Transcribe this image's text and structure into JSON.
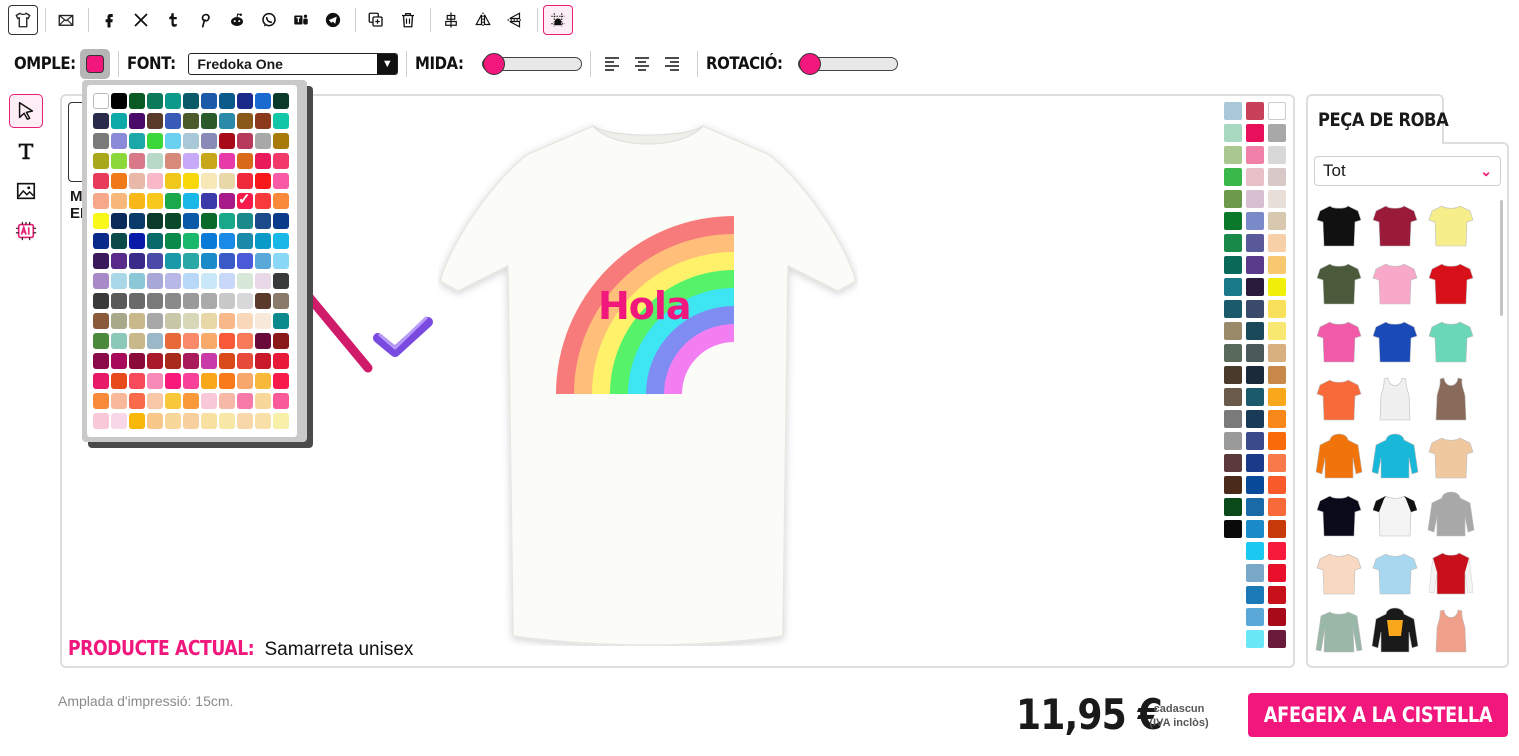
{
  "toolbar": {
    "icons": [
      "tshirt-icon",
      "mail-icon",
      "facebook-icon",
      "x-icon",
      "tumblr-icon",
      "pinterest-icon",
      "reddit-icon",
      "whatsapp-icon",
      "teams-icon",
      "telegram-icon",
      "copy-icon",
      "trash-icon",
      "center-vertical-icon",
      "flip-horizontal-icon",
      "flip-vertical-icon",
      "grid-icon"
    ]
  },
  "props": {
    "fill_label": "OMPLE:",
    "fill_color": "#f2177d",
    "font_label": "FONT:",
    "font_value": "Fredoka One",
    "size_label": "MIDA:",
    "rotation_label": "ROTACIÓ:",
    "slider_color": "#f2177d"
  },
  "canvas": {
    "side_text_1": "M",
    "side_text_2": "EL",
    "design_text": "Hola",
    "current_label": "PRODUCTE ACTUAL:",
    "current_value": "Samarreta unisex"
  },
  "picker_colors": [
    "#ffffff",
    "#000000",
    "#0a5a24",
    "#0b7a5a",
    "#0d9a8a",
    "#0b5a6a",
    "#1a5aa8",
    "#0a5a8a",
    "#1a2a8a",
    "#1a6ad0",
    "#0a3a2a",
    "#2a2a4a",
    "#0da8a8",
    "#4a0a6a",
    "#5a3a2a",
    "#3a5ab8",
    "#4a5a2a",
    "#2a5a2a",
    "#2a8aa8",
    "#8a5a1a",
    "#8a3a1a",
    "#10c8a8",
    "#7a7a7a",
    "#8a8ad8",
    "#1aa8a8",
    "#3ad83a",
    "#6ad0f0",
    "#a8c8d8",
    "#8a8ab8",
    "#a80a1a",
    "#b83a5a",
    "#a8a8a8",
    "#a87a0a",
    "#a8a81a",
    "#8ad83a",
    "#d87a8a",
    "#b8d8c8",
    "#d88a7a",
    "#c8a8f8",
    "#c8a81a",
    "#e83aa8",
    "#d86a1a",
    "#e81a5a",
    "#f23a6a",
    "#e83a5a",
    "#f07a1a",
    "#e8b8a8",
    "#f8b8c8",
    "#f0c81a",
    "#f8d80a",
    "#f8e8b8",
    "#e8d8a8",
    "#f02a3a",
    "#f81a1a",
    "#f85aa8",
    "#f8a88a",
    "#f8b87a",
    "#f8b81a",
    "#f8c81a",
    "#1aa84a",
    "#1ab8e8",
    "#3a3aa8",
    "#a81a8a",
    "#f81a4a",
    "#f83a3a",
    "#f88a3a",
    "#f8f81a",
    "#0a2a5a",
    "#0a3a6a",
    "#0a3a2a",
    "#0a4a2a",
    "#0a5aa8",
    "#0a6a2a",
    "#1aa88a",
    "#1a8a8a",
    "#1a4a8a",
    "#0a3a8a",
    "#0a2a8a",
    "#0a4a4a",
    "#0a1aa8",
    "#0a6a6a",
    "#0a8a4a",
    "#1ab86a",
    "#0a7ad8",
    "#1a8ae8",
    "#1a8aa8",
    "#0a9ac8",
    "#1ab8e8",
    "#3a1a5a",
    "#5a2a8a",
    "#3a2a8a",
    "#4a4aa8",
    "#1a9aa8",
    "#2aa8a8",
    "#1a8ac8",
    "#3a5ac8",
    "#4a5ad8",
    "#5aa8d8",
    "#8ad8f8",
    "#a88ac8",
    "#a8d8e8",
    "#8ac8d8",
    "#a8a8d8",
    "#b8b8e8",
    "#b8d8f8",
    "#c8e8f8",
    "#c8d8f8",
    "#d8e8d8",
    "#e8d8e8",
    "#3a3a3a",
    "#3a3a3a",
    "#5a5a5a",
    "#6a6a6a",
    "#7a7a7a",
    "#8a8a8a",
    "#9a9a9a",
    "#aaaaaa",
    "#c8c8c8",
    "#d8d8d8",
    "#5a3a2a",
    "#8a7a6a",
    "#8a5a3a",
    "#a8a88a",
    "#c8b88a",
    "#a8a8a8",
    "#c8c8a8",
    "#d8d8b8",
    "#e8d8a8",
    "#f8b88a",
    "#f8d8b8",
    "#f8e8d8",
    "#0a8a8a",
    "#4a8a3a",
    "#8ac8b8",
    "#c8b88a",
    "#9ab8c8",
    "#e86a3a",
    "#f88a6a",
    "#f8aa6a",
    "#f85a3a",
    "#f87a5a",
    "#6a0a3a",
    "#8a1a1a",
    "#8a0a4a",
    "#a80a5a",
    "#8a0a3a",
    "#a81a2a",
    "#a82a1a",
    "#a81a5a",
    "#c83aa8",
    "#d84a1a",
    "#e84a3a",
    "#c81a2a",
    "#e81a3a",
    "#e81a6a",
    "#e84a1a",
    "#f84a5a",
    "#f88ab8",
    "#f81a7a",
    "#f8429a",
    "#f8a81a",
    "#f87a1a",
    "#f8a86a",
    "#f8b83a",
    "#f81a4a",
    "#f88a3a",
    "#f8b89a",
    "#f86a4a",
    "#f8c8a8",
    "#f8c83a",
    "#f89a3a",
    "#f8c8d8",
    "#f8b8a8",
    "#f87aa8",
    "#f8d89a",
    "#f85a9a",
    "#f8c8d8",
    "#f8d8e8",
    "#f8b80a",
    "#f8c88a",
    "#f8d89a",
    "#f8d0a0",
    "#f8e0a0",
    "#f8e8a8",
    "#f8d8a8",
    "#f8e0a8",
    "#f8f0a8"
  ],
  "picker_selected": 63,
  "garment_colors": [
    "#a8c8d8",
    "#c8405a",
    "#ffffff",
    "#a8d8c0",
    "#e8105a",
    "#a8a8a8",
    "#a8c890",
    "#f080a8",
    "#d8d8d8",
    "#3ab84a",
    "#e8c0c8",
    "#d8c8c8",
    "#6a9a4a",
    "#d8c0d0",
    "#e8e0d8",
    "#0a7a2a",
    "#7a8ac8",
    "#d8c8b0",
    "#1a8a4a",
    "#5a5a9a",
    "#f8d0a8",
    "#0a6a5a",
    "#5a3a8a",
    "#f8c870",
    "#1a7a8a",
    "#2a1a3a",
    "#f0f00a",
    "#1a5a6a",
    "#3a4a6a",
    "#f8e05a",
    "#9a8a6a",
    "#1a4a5a",
    "#f8e870",
    "#5a6a5a",
    "#4a5a5a",
    "#d8b080",
    "#4a3a2a",
    "#1a2a3a",
    "#c8884a",
    "#6a5a4a",
    "#1a5a6a",
    "#f8a81a",
    "#7a7a7a",
    "#1a3a5a",
    "#f8881a",
    "#9a9a9a",
    "#3a4a8a",
    "#f86a0a",
    "#5a3a3a",
    "#1a3a8a",
    "#f87a4a",
    "#4a2a1a",
    "#0a4a9a",
    "#f85a2a",
    "#0a4a1a",
    "#1a6aa8",
    "#f86a3a",
    "#0a0a0a",
    "#1a8ac8",
    "#c83a0a",
    "",
    "#1ac8f0",
    "#f81a3a",
    "",
    "#7aa8c8",
    "#e8102a",
    "",
    "#1a7ab8",
    "#c8101a",
    "",
    "#5aa8d8",
    "#a80a1a",
    "",
    "#6ae8f8",
    "#6a1a3a"
  ],
  "product_panel": {
    "tab_label": "PEÇA DE ROBA",
    "filter_value": "Tot",
    "products": [
      {
        "name": "tshirt-black-icon",
        "color": "#111111",
        "style": "tee"
      },
      {
        "name": "tshirt-burgundy-icon",
        "color": "#9a1a3a",
        "style": "tee"
      },
      {
        "name": "tshirt-yellow-icon",
        "color": "#f5ee8a",
        "style": "tee"
      },
      {
        "name": "tshirt-olive-icon",
        "color": "#4a5a3a",
        "style": "tee"
      },
      {
        "name": "tshirt-pink-icon",
        "color": "#f8a8c8",
        "style": "tee"
      },
      {
        "name": "tshirt-red-icon",
        "color": "#d8101a",
        "style": "tee"
      },
      {
        "name": "tshirt-fuchsia-icon",
        "color": "#f05aa8",
        "style": "tee"
      },
      {
        "name": "tshirt-royal-blue-icon",
        "color": "#1a4ab8",
        "style": "tee"
      },
      {
        "name": "tshirt-mint-icon",
        "color": "#6ad8b8",
        "style": "tee"
      },
      {
        "name": "tshirt-orange-icon",
        "color": "#f86a3a",
        "style": "tee"
      },
      {
        "name": "tanktop-white-icon",
        "color": "#f0f0f0",
        "style": "tank"
      },
      {
        "name": "tanktop-brown-icon",
        "color": "#8a6a5a",
        "style": "tank"
      },
      {
        "name": "hoodie-orange-icon",
        "color": "#f0740a",
        "style": "hoodie"
      },
      {
        "name": "hoodie-cyan-icon",
        "color": "#1ab8d8",
        "style": "hoodie"
      },
      {
        "name": "tshirt-tiedye-icon",
        "color": "#f0c8a0",
        "style": "tee"
      },
      {
        "name": "tshirt-black-2-icon",
        "color": "#0a0a1a",
        "style": "tee"
      },
      {
        "name": "raglan-black-white-icon",
        "color": "#f4f4f4",
        "style": "raglan"
      },
      {
        "name": "hoodie-grey-icon",
        "color": "#a8a8a8",
        "style": "hoodie"
      },
      {
        "name": "tshirt-peach-icon",
        "color": "#f8d8c0",
        "style": "tee"
      },
      {
        "name": "tshirt-gradient-blue-icon",
        "color": "#a8d8f0",
        "style": "tee"
      },
      {
        "name": "varsity-jacket-red-icon",
        "color": "#c8101a",
        "style": "jacket"
      },
      {
        "name": "longsleeve-sage-icon",
        "color": "#9ab8a8",
        "style": "long"
      },
      {
        "name": "hoodie-black-orange-icon",
        "color": "#1a1a1a",
        "style": "hoodie"
      },
      {
        "name": "tanktop-salmon-icon",
        "color": "#f0a08a",
        "style": "tank"
      }
    ]
  },
  "footer": {
    "print_width": "Amplada d'impressió: 15cm.",
    "price": "11,95 €",
    "price_note_1": "cadascun",
    "price_note_2": "(IVA inclòs)",
    "add_to_cart": "AFEGEIX A LA CISTELLA"
  }
}
